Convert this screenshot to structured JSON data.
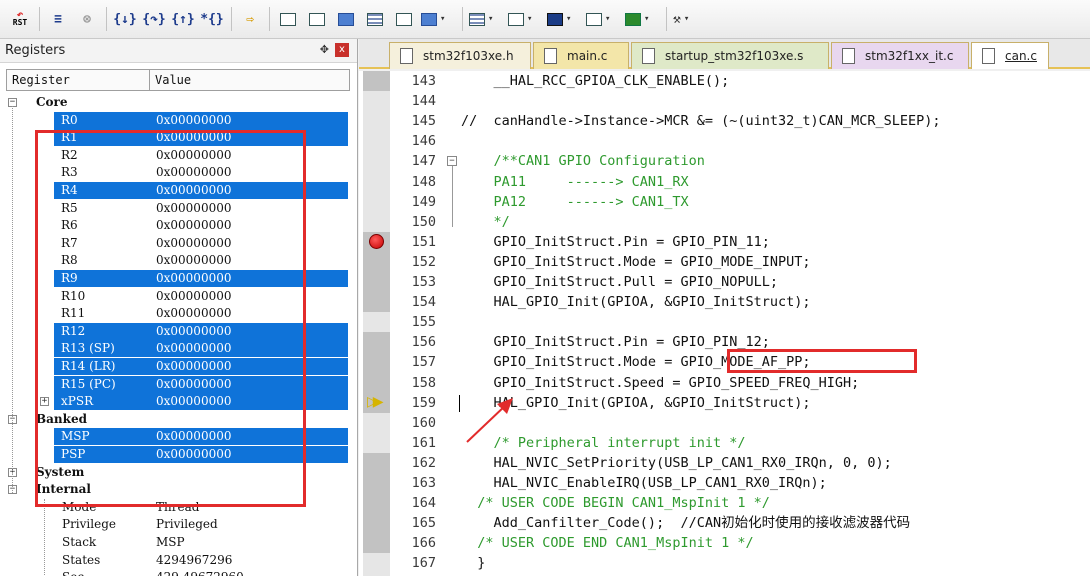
{
  "toolbar": {
    "rst_label": "RST",
    "buttons": [
      {
        "name": "reset-cpu-icon",
        "glyph": "RST"
      },
      {
        "name": "run-icon",
        "glyph": "≡"
      },
      {
        "name": "stop-icon",
        "glyph": "⊗"
      },
      {
        "name": "step-into-icon",
        "glyph": "{}"
      },
      {
        "name": "step-over-icon",
        "glyph": "{}"
      },
      {
        "name": "step-out-icon",
        "glyph": "{}"
      },
      {
        "name": "run-to-cursor-icon",
        "glyph": "*{}"
      },
      {
        "name": "show-next-statement-icon",
        "glyph": "⇨"
      }
    ]
  },
  "registers_pane": {
    "title": "Registers",
    "pin_glyph": "✥",
    "close_glyph": "x",
    "column_register": "Register",
    "column_value": "Value",
    "rows": [
      {
        "name": "Core",
        "value": "",
        "type": "group",
        "expander": "−",
        "selected": false
      },
      {
        "name": "R0",
        "value": "0x00000000",
        "type": "reg",
        "selected": true
      },
      {
        "name": "R1",
        "value": "0x00000000",
        "type": "reg",
        "selected": true
      },
      {
        "name": "R2",
        "value": "0x00000000",
        "type": "reg",
        "selected": false
      },
      {
        "name": "R3",
        "value": "0x00000000",
        "type": "reg",
        "selected": false
      },
      {
        "name": "R4",
        "value": "0x00000000",
        "type": "reg",
        "selected": true
      },
      {
        "name": "R5",
        "value": "0x00000000",
        "type": "reg",
        "selected": false
      },
      {
        "name": "R6",
        "value": "0x00000000",
        "type": "reg",
        "selected": false
      },
      {
        "name": "R7",
        "value": "0x00000000",
        "type": "reg",
        "selected": false
      },
      {
        "name": "R8",
        "value": "0x00000000",
        "type": "reg",
        "selected": false
      },
      {
        "name": "R9",
        "value": "0x00000000",
        "type": "reg",
        "selected": true
      },
      {
        "name": "R10",
        "value": "0x00000000",
        "type": "reg",
        "selected": false
      },
      {
        "name": "R11",
        "value": "0x00000000",
        "type": "reg",
        "selected": false
      },
      {
        "name": "R12",
        "value": "0x00000000",
        "type": "reg",
        "selected": true
      },
      {
        "name": "R13 (SP)",
        "value": "0x00000000",
        "type": "reg",
        "selected": true
      },
      {
        "name": "R14 (LR)",
        "value": "0x00000000",
        "type": "reg",
        "selected": true
      },
      {
        "name": "R15 (PC)",
        "value": "0x00000000",
        "type": "reg",
        "selected": true
      },
      {
        "name": "xPSR",
        "value": "0x00000000",
        "type": "reg",
        "selected": true,
        "expander": "+"
      },
      {
        "name": "Banked",
        "value": "",
        "type": "group",
        "expander": "−",
        "selected": false
      },
      {
        "name": "MSP",
        "value": "0x00000000",
        "type": "reg",
        "selected": true
      },
      {
        "name": "PSP",
        "value": "0x00000000",
        "type": "reg",
        "selected": true
      },
      {
        "name": "System",
        "value": "",
        "type": "group",
        "expander": "+",
        "selected": false
      },
      {
        "name": "Internal",
        "value": "",
        "type": "group",
        "expander": "−",
        "selected": false
      },
      {
        "name": "Mode",
        "value": "Thread",
        "type": "sub",
        "selected": false
      },
      {
        "name": "Privilege",
        "value": "Privileged",
        "type": "sub",
        "selected": false
      },
      {
        "name": "Stack",
        "value": "MSP",
        "type": "sub",
        "selected": false
      },
      {
        "name": "States",
        "value": "4294967296",
        "type": "sub",
        "selected": false
      },
      {
        "name": "Sec",
        "value": "429.49672960",
        "type": "sub",
        "selected": false
      }
    ]
  },
  "editor_tabs": [
    {
      "label": "stm32f103xe.h",
      "active": false,
      "color": "#f5f0dc"
    },
    {
      "label": "main.c",
      "active": false,
      "color": "#f3e6a9"
    },
    {
      "label": "startup_stm32f103xe.s",
      "active": false,
      "color": "#dfe9c8"
    },
    {
      "label": "stm32f1xx_it.c",
      "active": false,
      "color": "#e8d7ef"
    },
    {
      "label": "can.c",
      "active": true,
      "color": "#ffffff"
    }
  ],
  "code_lines": [
    {
      "n": "143",
      "text": "    __HAL_RCC_GPIOA_CLK_ENABLE();",
      "comment": false
    },
    {
      "n": "144",
      "text": "",
      "comment": false
    },
    {
      "n": "145",
      "text": "//  canHandle->Instance->MCR &= (~(uint32_t)CAN_MCR_SLEEP);",
      "comment": false
    },
    {
      "n": "146",
      "text": "",
      "comment": false
    },
    {
      "n": "147",
      "text": "    /**CAN1 GPIO Configuration",
      "comment": true
    },
    {
      "n": "148",
      "text": "    PA11     ------> CAN1_RX",
      "comment": true
    },
    {
      "n": "149",
      "text": "    PA12     ------> CAN1_TX",
      "comment": true
    },
    {
      "n": "150",
      "text": "    */",
      "comment": true
    },
    {
      "n": "151",
      "text": "    GPIO_InitStruct.Pin = GPIO_PIN_11;",
      "comment": false
    },
    {
      "n": "152",
      "text": "    GPIO_InitStruct.Mode = GPIO_MODE_INPUT;",
      "comment": false
    },
    {
      "n": "153",
      "text": "    GPIO_InitStruct.Pull = GPIO_NOPULL;",
      "comment": false
    },
    {
      "n": "154",
      "text": "    HAL_GPIO_Init(GPIOA, &GPIO_InitStruct);",
      "comment": false
    },
    {
      "n": "155",
      "text": "",
      "comment": false
    },
    {
      "n": "156",
      "text": "    GPIO_InitStruct.Pin = GPIO_PIN_12;",
      "comment": false
    },
    {
      "n": "157",
      "text": "    GPIO_InitStruct.Mode = GPIO_MODE_AF_PP;",
      "comment": false
    },
    {
      "n": "158",
      "text": "    GPIO_InitStruct.Speed = GPIO_SPEED_FREQ_HIGH;",
      "comment": false
    },
    {
      "n": "159",
      "text": "    HAL_GPIO_Init(GPIOA, &GPIO_InitStruct);",
      "comment": false
    },
    {
      "n": "160",
      "text": "",
      "comment": false
    },
    {
      "n": "161",
      "text": "    /* Peripheral interrupt init */",
      "comment": true
    },
    {
      "n": "162",
      "text": "    HAL_NVIC_SetPriority(USB_LP_CAN1_RX0_IRQn, 0, 0);",
      "comment": false
    },
    {
      "n": "163",
      "text": "    HAL_NVIC_EnableIRQ(USB_LP_CAN1_RX0_IRQn);",
      "comment": false
    },
    {
      "n": "164",
      "text": "  /* USER CODE BEGIN CAN1_MspInit 1 */",
      "comment": true
    },
    {
      "n": "165",
      "text": "    Add_Canfilter_Code();  //CAN初始化时使用的接收滤波器代码",
      "comment": false
    },
    {
      "n": "166",
      "text": "  /* USER CODE END CAN1_MspInit 1 */",
      "comment": true
    },
    {
      "n": "167",
      "text": "  }",
      "comment": false
    }
  ],
  "colors": {
    "selection": "#0f73d9",
    "annotation_red": "#e22b2b",
    "comment_green": "#2e9a2e"
  }
}
